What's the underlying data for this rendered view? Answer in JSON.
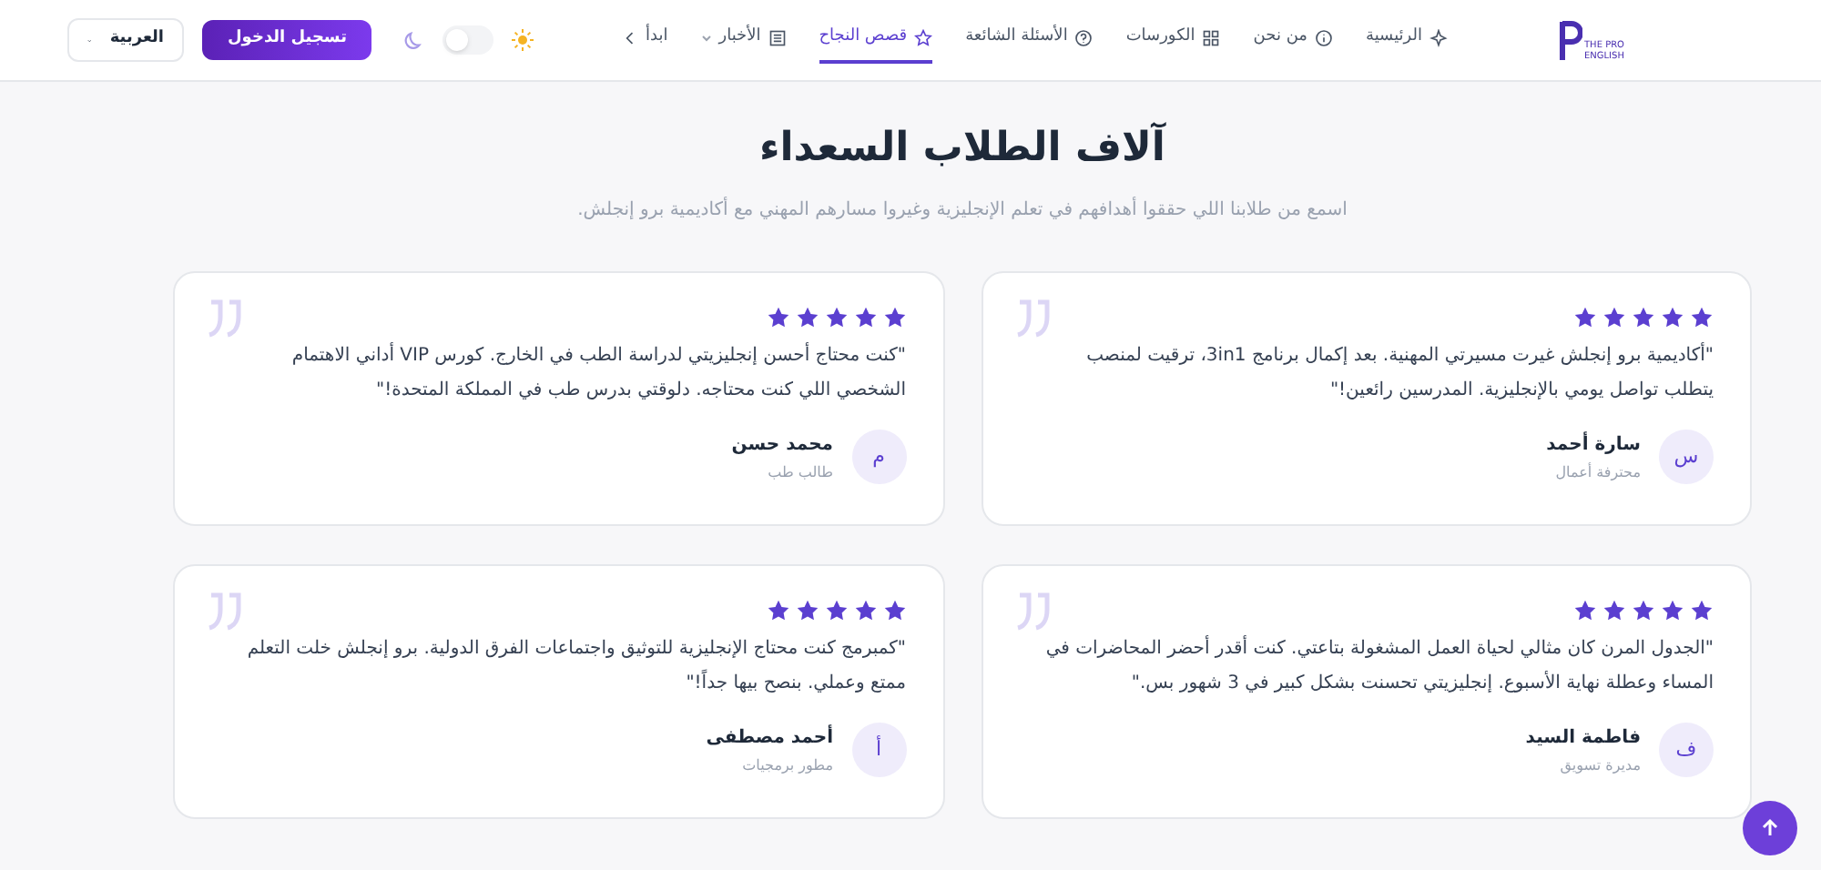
{
  "logo": {
    "text": "THE PRO ENGLISH"
  },
  "nav": [
    {
      "label": "الرئيسية",
      "selected": false
    },
    {
      "label": "من نحن",
      "selected": false
    },
    {
      "label": "الكورسات",
      "selected": false
    },
    {
      "label": "الأسئلة الشائعة",
      "selected": false
    },
    {
      "label": "قصص النجاح",
      "selected": true
    },
    {
      "label": "الأخبار",
      "selected": false,
      "dropdown": true
    },
    {
      "label": "ابدأ",
      "selected": false
    }
  ],
  "theme_toggle": {
    "on": false
  },
  "login_button": "تسجيل الدخول",
  "language": "العربية",
  "heading": "آلاف الطلاب السعداء",
  "subtitle": "اسمع من طلابنا اللي حققوا أهدافهم في تعلم الإنجليزية وغيروا مسارهم المهني مع أكاديمية برو إنجلش.",
  "testimonials": [
    {
      "stars": 5,
      "quote": "\"أكاديمية برو إنجلش غيرت مسيرتي المهنية. بعد إكمال برنامج 3in1، ترقيت لمنصب يتطلب تواصل يومي بالإنجليزية. المدرسين رائعين!\"",
      "name": "سارة أحمد",
      "role": "محترفة أعمال",
      "initial": "س"
    },
    {
      "stars": 5,
      "quote": "\"كنت محتاج أحسن إنجليزيتي لدراسة الطب في الخارج. كورس VIP أداني الاهتمام الشخصي اللي كنت محتاجه. دلوقتي بدرس طب في المملكة المتحدة!\"",
      "name": "محمد حسن",
      "role": "طالب طب",
      "initial": "م"
    },
    {
      "stars": 5,
      "quote": "\"الجدول المرن كان مثالي لحياة العمل المشغولة بتاعتي. كنت أقدر أحضر المحاضرات في المساء وعطلة نهاية الأسبوع. إنجليزيتي تحسنت بشكل كبير في 3 شهور بس.\"",
      "name": "فاطمة السيد",
      "role": "مديرة تسويق",
      "initial": "ف"
    },
    {
      "stars": 5,
      "quote": "\"كمبرمج كنت محتاج الإنجليزية للتوثيق واجتماعات الفرق الدولية. برو إنجلش خلت التعلم ممتع وعملي. بنصح بيها جداً!\"",
      "name": "أحمد مصطفى",
      "role": "مطور برمجيات",
      "initial": "أ"
    }
  ]
}
